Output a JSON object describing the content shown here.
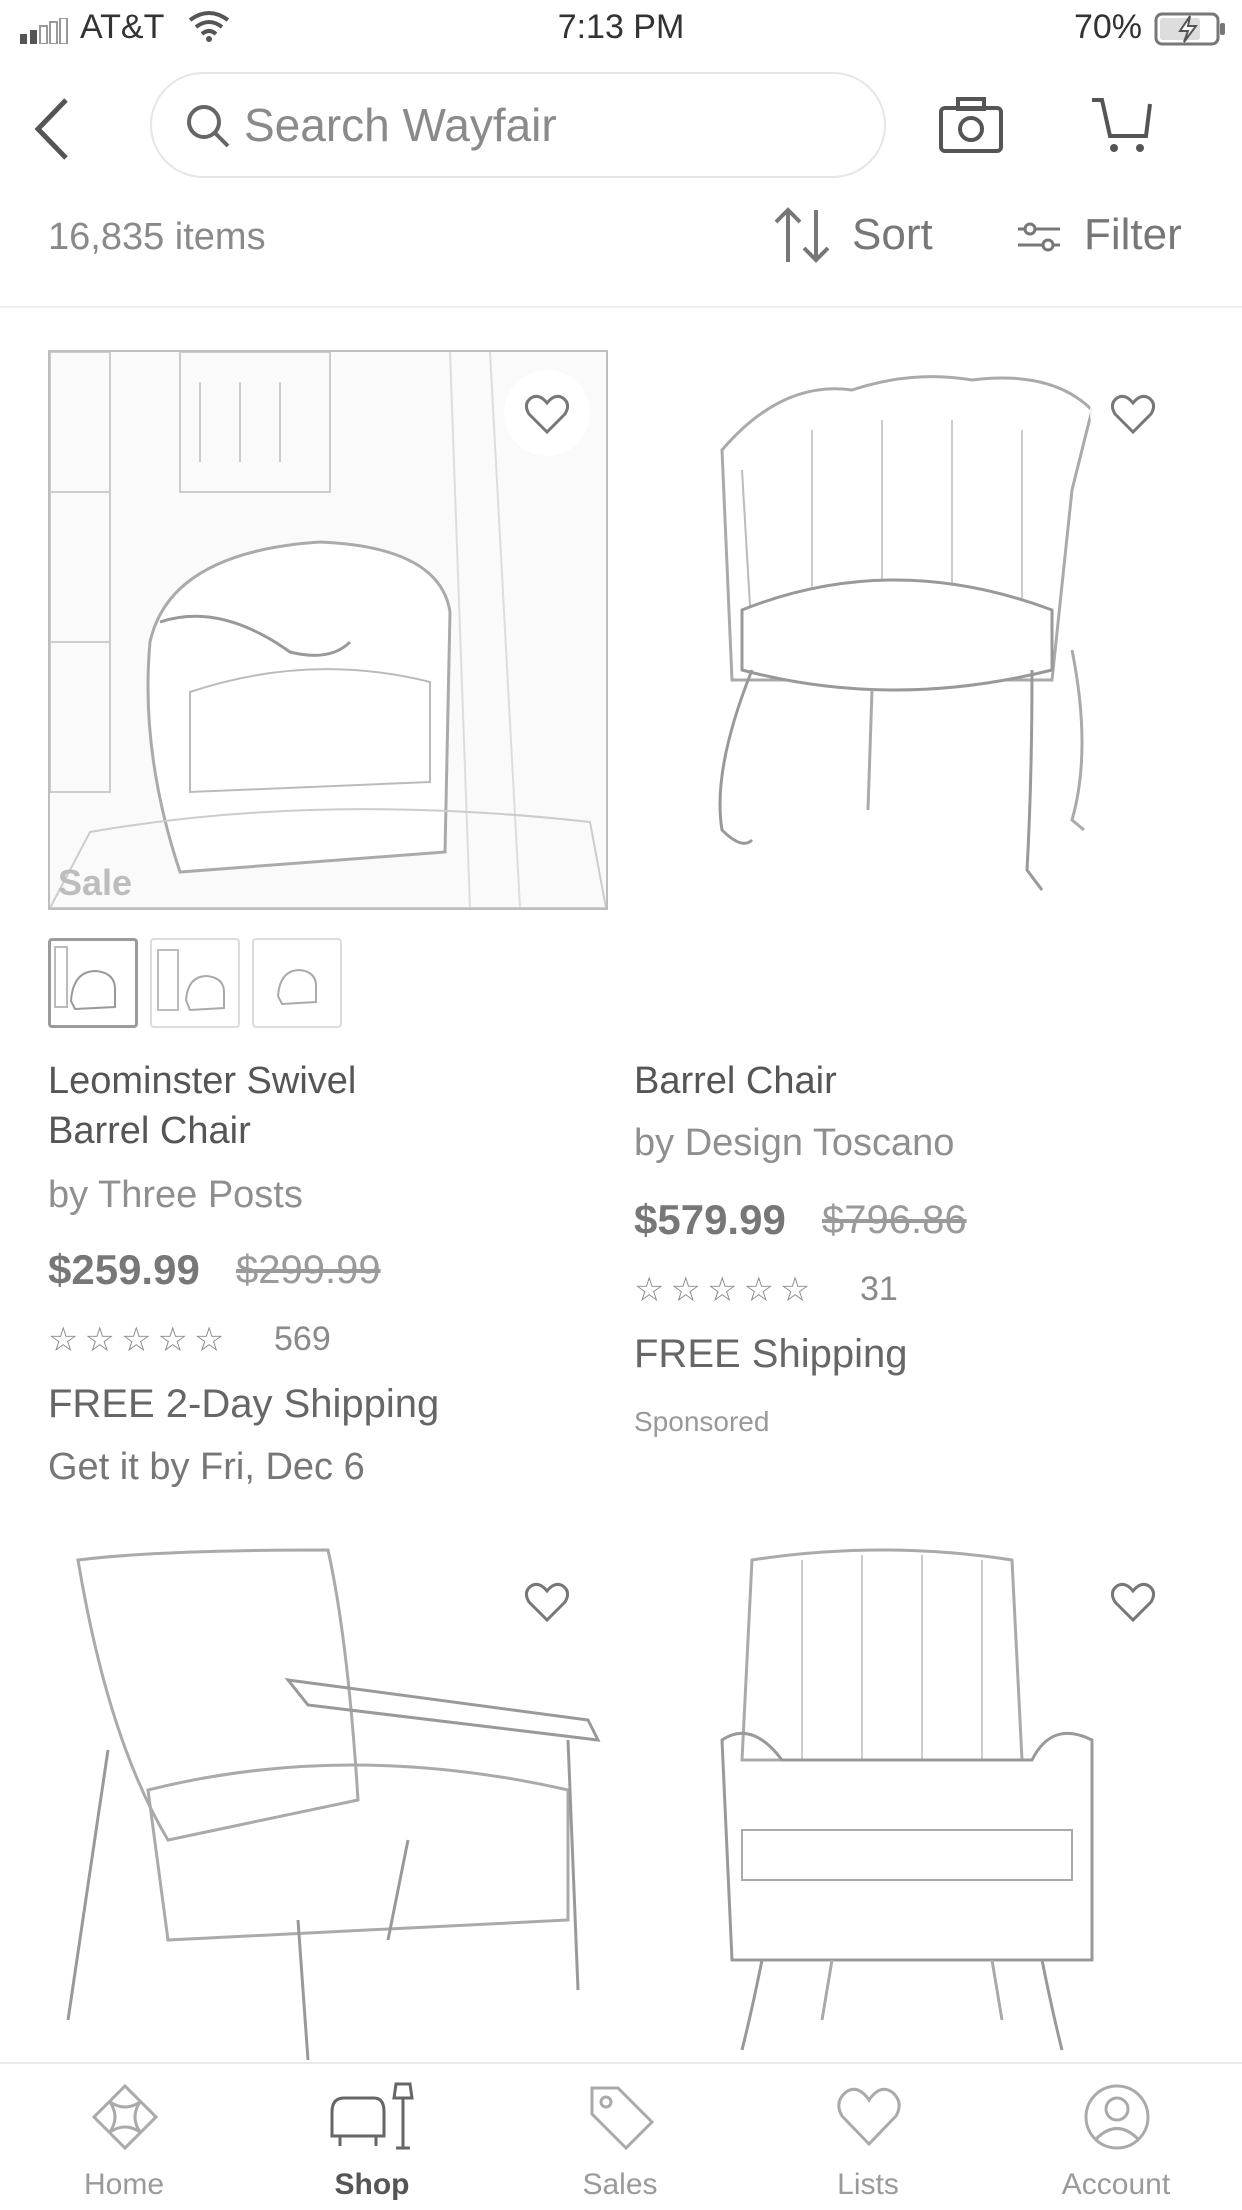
{
  "status_bar": {
    "carrier": "AT&T",
    "time": "7:13 PM",
    "battery": "70%"
  },
  "header": {
    "search_placeholder": "Search Wayfair"
  },
  "toolbar": {
    "count": "16,835 items",
    "sort": "Sort",
    "filter": "Filter"
  },
  "products": [
    {
      "badge": "Sale",
      "title_line1": "Leominster Swivel",
      "title_line2": "Barrel Chair",
      "brand": "by Three Posts",
      "price": "$259.99",
      "original_price": "$299.99",
      "rating": 5,
      "review_count": "569",
      "shipping": "FREE 2-Day Shipping",
      "delivery": "Get it by Fri, Dec 6"
    },
    {
      "title_line1": "Barrel Chair",
      "brand": "by Design Toscano",
      "price": "$579.99",
      "original_price": "$796.86",
      "rating": 4.5,
      "review_count": "31",
      "shipping": "FREE Shipping",
      "sponsored": "Sponsored"
    }
  ],
  "tabs": [
    {
      "label": "Home",
      "icon": "home-icon"
    },
    {
      "label": "Shop",
      "icon": "shop-icon",
      "active": true
    },
    {
      "label": "Sales",
      "icon": "sales-tag-icon"
    },
    {
      "label": "Lists",
      "icon": "heart-icon"
    },
    {
      "label": "Account",
      "icon": "account-icon"
    }
  ]
}
